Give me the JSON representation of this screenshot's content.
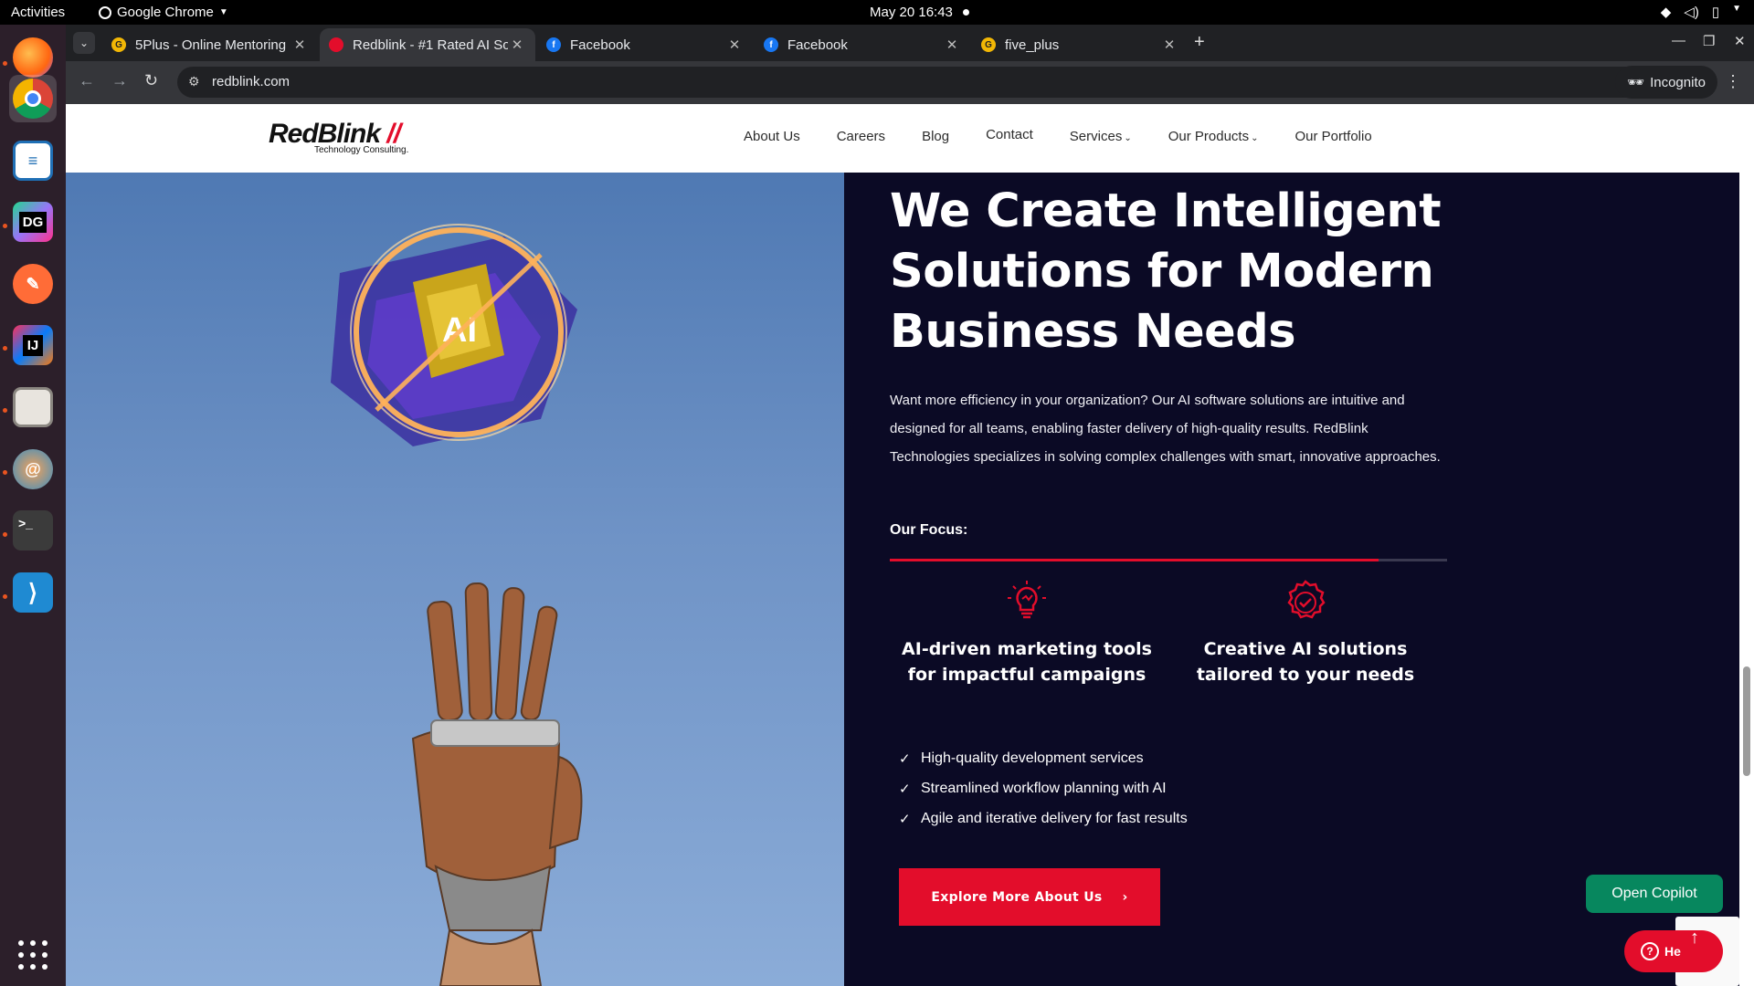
{
  "topbar": {
    "activities": "Activities",
    "app_name": "Google Chrome",
    "clock": "May 20  16:43"
  },
  "dock": {
    "items": [
      "firefox",
      "chrome",
      "writer",
      "datagrip",
      "postman",
      "intellij",
      "files",
      "blender",
      "terminal",
      "vscode"
    ]
  },
  "browser": {
    "tabs": [
      {
        "title": "5Plus - Online Mentoring",
        "active": false
      },
      {
        "title": "Redblink - #1 Rated AI So",
        "active": true
      },
      {
        "title": "Facebook",
        "active": false
      },
      {
        "title": "Facebook",
        "active": false
      },
      {
        "title": "five_plus",
        "active": false
      }
    ],
    "url": "redblink.com",
    "incognito_label": "Incognito"
  },
  "site": {
    "logo_text_a": "Red",
    "logo_text_b": "Blink",
    "logo_tagline": "Technology Consulting.",
    "nav": [
      "About Us",
      "Careers",
      "Blog",
      "Contact",
      "Services",
      "Our Products",
      "Our Portfolio"
    ],
    "headline": "We Create Intelligent Solutions for Modern Business Needs",
    "intro": "Want more efficiency in your organization? Our AI software solutions are intuitive and designed for all teams, enabling faster delivery of high-quality results. RedBlink Technologies specializes in solving complex challenges with smart, innovative approaches.",
    "focus_label": "Our Focus:",
    "focus_cards": [
      {
        "text": "AI-driven marketing tools for impactful campaigns",
        "icon": "lightbulb-icon"
      },
      {
        "text": "Creative AI solutions tailored to your needs",
        "icon": "badge-check-icon"
      }
    ],
    "checklist": [
      "High-quality development services",
      "Streamlined workflow planning with AI",
      "Agile and iterative delivery for fast results"
    ],
    "cta_label": "Explore More About Us",
    "copilot_label": "Open Copilot",
    "help_label": "He",
    "hero_image_text": "AI"
  },
  "colors": {
    "brand_red": "#e30d2b",
    "page_bg": "#0b0a25",
    "copilot_green": "#07875e"
  }
}
